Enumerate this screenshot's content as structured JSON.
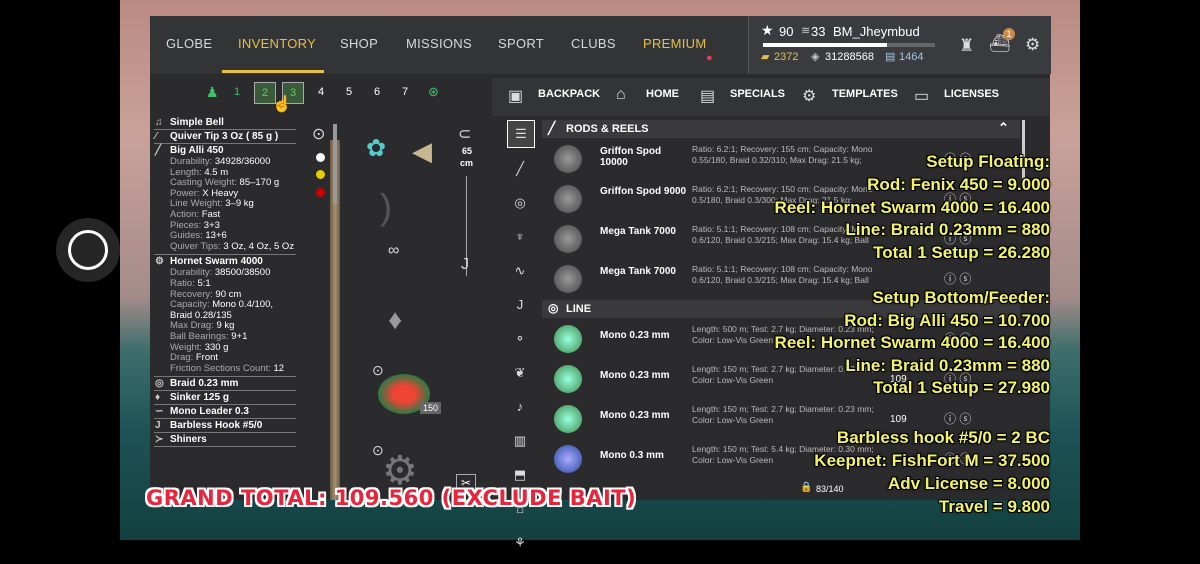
{
  "nav": {
    "tabs": [
      "GLOBE",
      "INVENTORY",
      "SHOP",
      "MISSIONS",
      "SPORT",
      "CLUBS",
      "PREMIUM"
    ],
    "active": "INVENTORY"
  },
  "player": {
    "level": "90",
    "rank": "33",
    "name": "BM_Jheymbud",
    "gold": "2372",
    "silver": "31288568",
    "tickets": "1464",
    "notifications": "1",
    "level_progress": 0.72
  },
  "slots": [
    "1",
    "2",
    "3",
    "4",
    "5",
    "6",
    "7"
  ],
  "subnav": {
    "backpack": "BACKPACK",
    "home": "HOME",
    "specials": "SPECIALS",
    "templates": "TEMPLATES",
    "licenses": "LICENSES"
  },
  "left": {
    "bell": "Simple Bell",
    "quiver": "Quiver Tip 3 Oz ( 85 g )",
    "rod": {
      "name": "Big Alli 450",
      "stats": [
        [
          "Durability:",
          "34928/36000"
        ],
        [
          "Length:",
          "4.5 m"
        ],
        [
          "Casting Weight:",
          "85–170 g"
        ],
        [
          "Power:",
          "X Heavy"
        ],
        [
          "Line Weight:",
          "3–9 kg"
        ],
        [
          "Action:",
          "Fast"
        ],
        [
          "Pieces:",
          "3+3"
        ],
        [
          "Guides:",
          "13+6"
        ],
        [
          "Quiver Tips:",
          "3 Oz, 4 Oz, 5 Oz"
        ]
      ]
    },
    "reel": {
      "name": "Hornet Swarm 4000",
      "stats": [
        [
          "Durability:",
          "38500/38500"
        ],
        [
          "Ratio:",
          "5:1"
        ],
        [
          "Recovery:",
          "90 cm"
        ],
        [
          "Capacity:",
          "Mono 0.4/100, Braid 0.28/135"
        ],
        [
          "Max Drag:",
          "9 kg"
        ],
        [
          "Ball Bearings:",
          "9+1"
        ],
        [
          "Weight:",
          "330 g"
        ],
        [
          "Drag:",
          "Front"
        ],
        [
          "Friction Sections Count:",
          "12"
        ]
      ]
    },
    "line": "Braid 0.23 mm",
    "sinker": "Sinker 125 g",
    "leader": "Mono Leader 0.3",
    "hook": "Barbless Hook #5/0",
    "bait": "Shiners"
  },
  "mid": {
    "length": "65",
    "length_unit": "cm",
    "spool_count": "150"
  },
  "sections": {
    "rods": "RODS & REELS",
    "line": "LINE"
  },
  "rods": [
    {
      "name": "Griffon Spod 10000",
      "desc": "Ratio: 6.2:1; Recovery: 155 cm; Capacity: Mono 0.55/180, Braid 0.32/310; Max Drag: 21.5 kg;"
    },
    {
      "name": "Griffon Spod 9000",
      "desc": "Ratio: 6.2:1; Recovery: 150 cm; Capacity: Mono 0.5/180, Braid 0.3/300; Max Drag: 21.5 kg;"
    },
    {
      "name": "Mega Tank 7000",
      "desc": "Ratio: 5.1:1; Recovery: 108 cm; Capacity: Mono 0.6/120, Braid 0.3/215; Max Drag: 15.4 kg; Ball"
    },
    {
      "name": "Mega Tank 7000",
      "desc": "Ratio: 5.1:1; Recovery: 108 cm; Capacity: Mono 0.6/120, Braid 0.3/215; Max Drag: 15.4 kg; Ball"
    }
  ],
  "lines": [
    {
      "name": "Mono 0.23 mm",
      "desc": "Length: 500 m; Test: 2.7 kg; Diameter: 0.23 mm; Color: Low-Vis Green",
      "count": ""
    },
    {
      "name": "Mono 0.23 mm",
      "desc": "Length: 150 m; Test: 2.7 kg; Diameter: 0.23 mm; Color: Low-Vis Green",
      "count": "109"
    },
    {
      "name": "Mono 0.23 mm",
      "desc": "Length: 150 m; Test: 2.7 kg; Diameter: 0.23 mm; Color: Low-Vis Green",
      "count": "109"
    },
    {
      "name": "Mono 0.3 mm",
      "desc": "Length: 150 m; Test: 5.4 kg; Diameter: 0.30 mm; Color: Low-Vis Green",
      "count": ""
    }
  ],
  "capacity": "83/140",
  "overlay": [
    "Setup Floating:",
    "Rod: Fenix 450 = 9.000",
    "Reel: Hornet Swarm 4000 = 16.400",
    "Line: Braid 0.23mm = 880",
    "Total 1 Setup = 26.280",
    "Setup Bottom/Feeder:",
    "Rod: Big Alli 450 = 10.700",
    "Reel: Hornet Swarm 4000 = 16.400",
    "Line: Braid 0.23mm = 880",
    "Total 1 Setup = 27.980",
    "Barbless hook #5/0 = 2 BC",
    "Keepnet: FishFort M = 37.500",
    "Adv License = 8.000",
    "Travel = 9.800"
  ],
  "grand_total": "GRAND TOTAL: 109.560 (EXCLUDE BAIT)"
}
